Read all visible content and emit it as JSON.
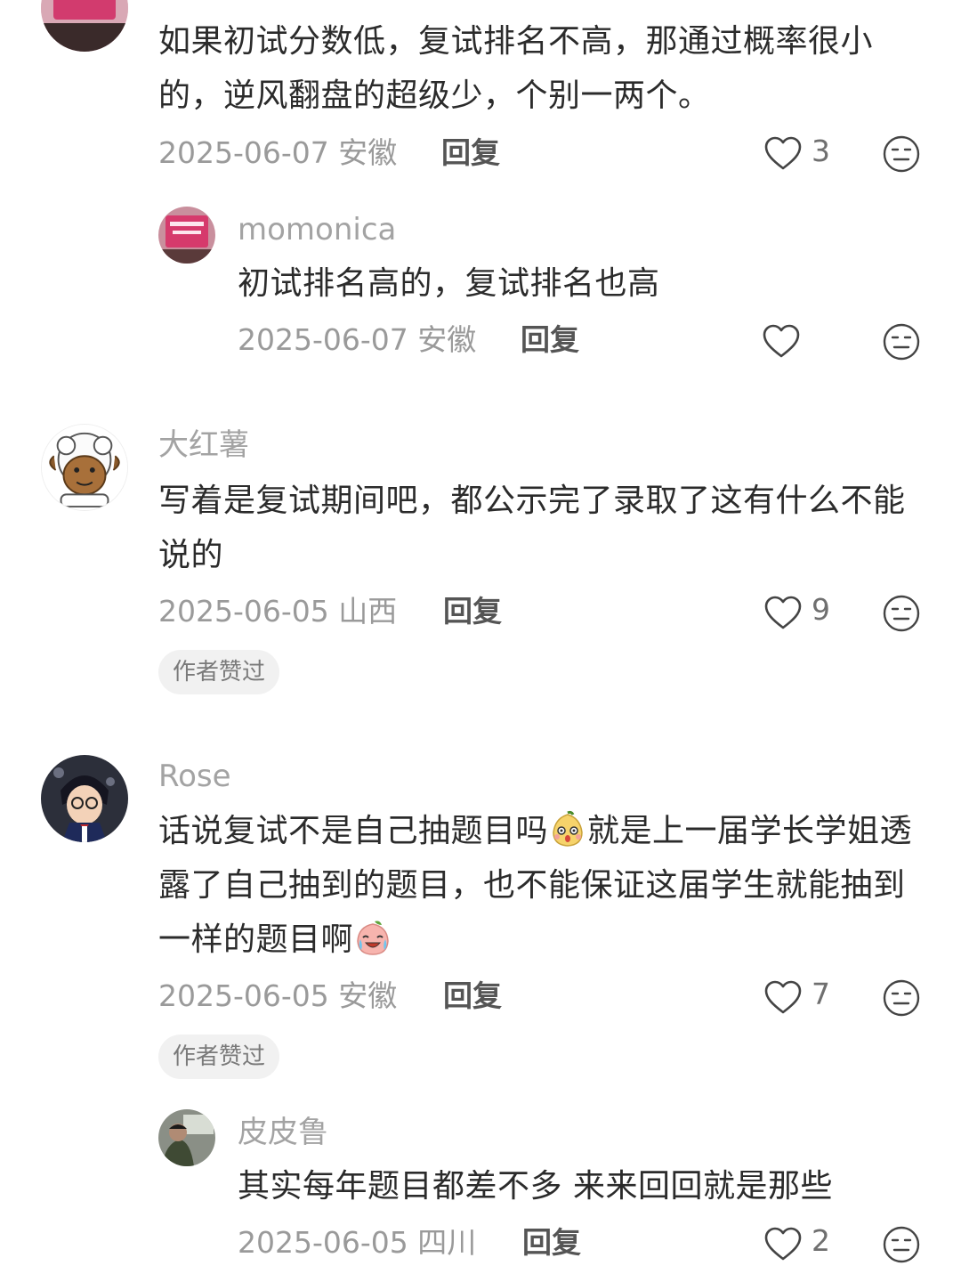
{
  "comments": [
    {
      "text": "如果初试分数低，复试排名不高，那通过概率很小的，逆风翻盘的超级少，个别一两个。",
      "date_location": "2025-06-07 安徽",
      "reply_label": "回复",
      "likes": "3",
      "replies": [
        {
          "username": "momonica",
          "text": "初试排名高的，复试排名也高",
          "date_location": "2025-06-07 安徽",
          "reply_label": "回复",
          "likes": ""
        }
      ]
    },
    {
      "username": "大红薯",
      "text": "写着是复试期间吧，都公示完了录取了这有什么不能说的",
      "date_location": "2025-06-05 山西",
      "reply_label": "回复",
      "likes": "9",
      "badge": "作者赞过"
    },
    {
      "username": "Rose",
      "text_part1": "话说复试不是自己抽题目吗",
      "text_part2": "就是上一届学长学姐透露了自己抽到的题目，也不能保证这届学生就能抽到一样的题目啊",
      "emoji1": "shocked-pear-emoji",
      "emoji2": "crying-laughing-peach-emoji",
      "date_location": "2025-06-05 安徽",
      "reply_label": "回复",
      "likes": "7",
      "badge": "作者赞过",
      "replies": [
        {
          "username": "皮皮鲁",
          "text": "其实每年题目都差不多 来来回回就是那些",
          "date_location": "2025-06-05 四川",
          "reply_label": "回复",
          "likes": "2"
        }
      ]
    }
  ],
  "icons": {
    "like": "heart-outline-icon",
    "react": "neutral-face-icon"
  },
  "colors": {
    "text": "#2b2b2b",
    "secondary": "#9a9a9a",
    "badge_bg": "#f1f1f1"
  }
}
